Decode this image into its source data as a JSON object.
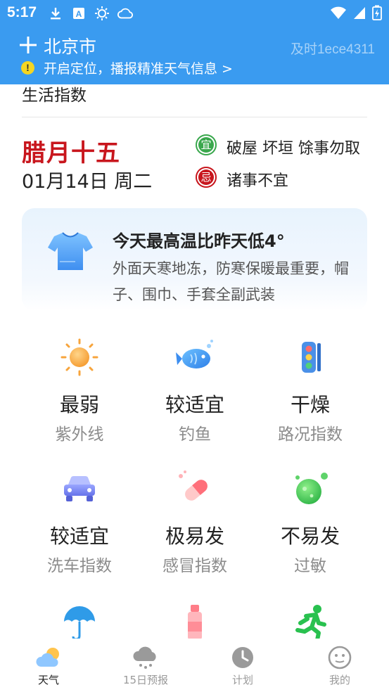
{
  "status_bar": {
    "time": "5:17",
    "left_icons": [
      "download-icon",
      "font-app-icon",
      "sun-icon",
      "weather-cloud-icon"
    ],
    "right_icons": [
      "wifi-icon",
      "signal-icon",
      "battery-charging-icon"
    ]
  },
  "header": {
    "city": "北京市",
    "add_icon": "plus-icon",
    "device_id": "及时1ece4311",
    "location_tip": "开启定位，播报精准天气信息 >",
    "warning_icon": "!"
  },
  "section": {
    "title": "生活指数"
  },
  "almanac": {
    "lunar_date": "腊月十五",
    "date": "01月14日 周二",
    "yi_badge": "宜",
    "yi_text": "破屋  坏垣  馀事勿取",
    "ji_badge": "忌",
    "ji_text": "诸事不宜"
  },
  "tip": {
    "icon": "tshirt-icon",
    "title": "今天最高温比昨天低4°",
    "description": "外面天寒地冻，防寒保暖最重要，帽子、围巾、手套全副武装"
  },
  "indices": [
    {
      "icon": "sun-icon",
      "value": "最弱",
      "label": "紫外线"
    },
    {
      "icon": "fish-icon",
      "value": "较适宜",
      "label": "钓鱼"
    },
    {
      "icon": "traffic-light-icon",
      "value": "干燥",
      "label": "路况指数"
    },
    {
      "icon": "car-icon",
      "value": "较适宜",
      "label": "洗车指数"
    },
    {
      "icon": "pill-icon",
      "value": "极易发",
      "label": "感冒指数"
    },
    {
      "icon": "allergy-icon",
      "value": "不易发",
      "label": "过敏"
    },
    {
      "icon": "umbrella-icon",
      "value": "",
      "label": ""
    },
    {
      "icon": "sunscreen-bottle-icon",
      "value": "",
      "label": ""
    },
    {
      "icon": "running-man-icon",
      "value": "",
      "label": ""
    }
  ],
  "bottom_nav": [
    {
      "icon": "weather-icon",
      "label": "天气",
      "active": true
    },
    {
      "icon": "cloud-rain-icon",
      "label": "15日预报",
      "active": false
    },
    {
      "icon": "clock-icon",
      "label": "计划",
      "active": false
    },
    {
      "icon": "smiley-icon",
      "label": "我的",
      "active": false
    }
  ],
  "colors": {
    "header_blue": "#3a9bf0",
    "lunar_red": "#c8161d",
    "yi_green": "#3aa84d",
    "label_gray": "#8c8c8c"
  }
}
